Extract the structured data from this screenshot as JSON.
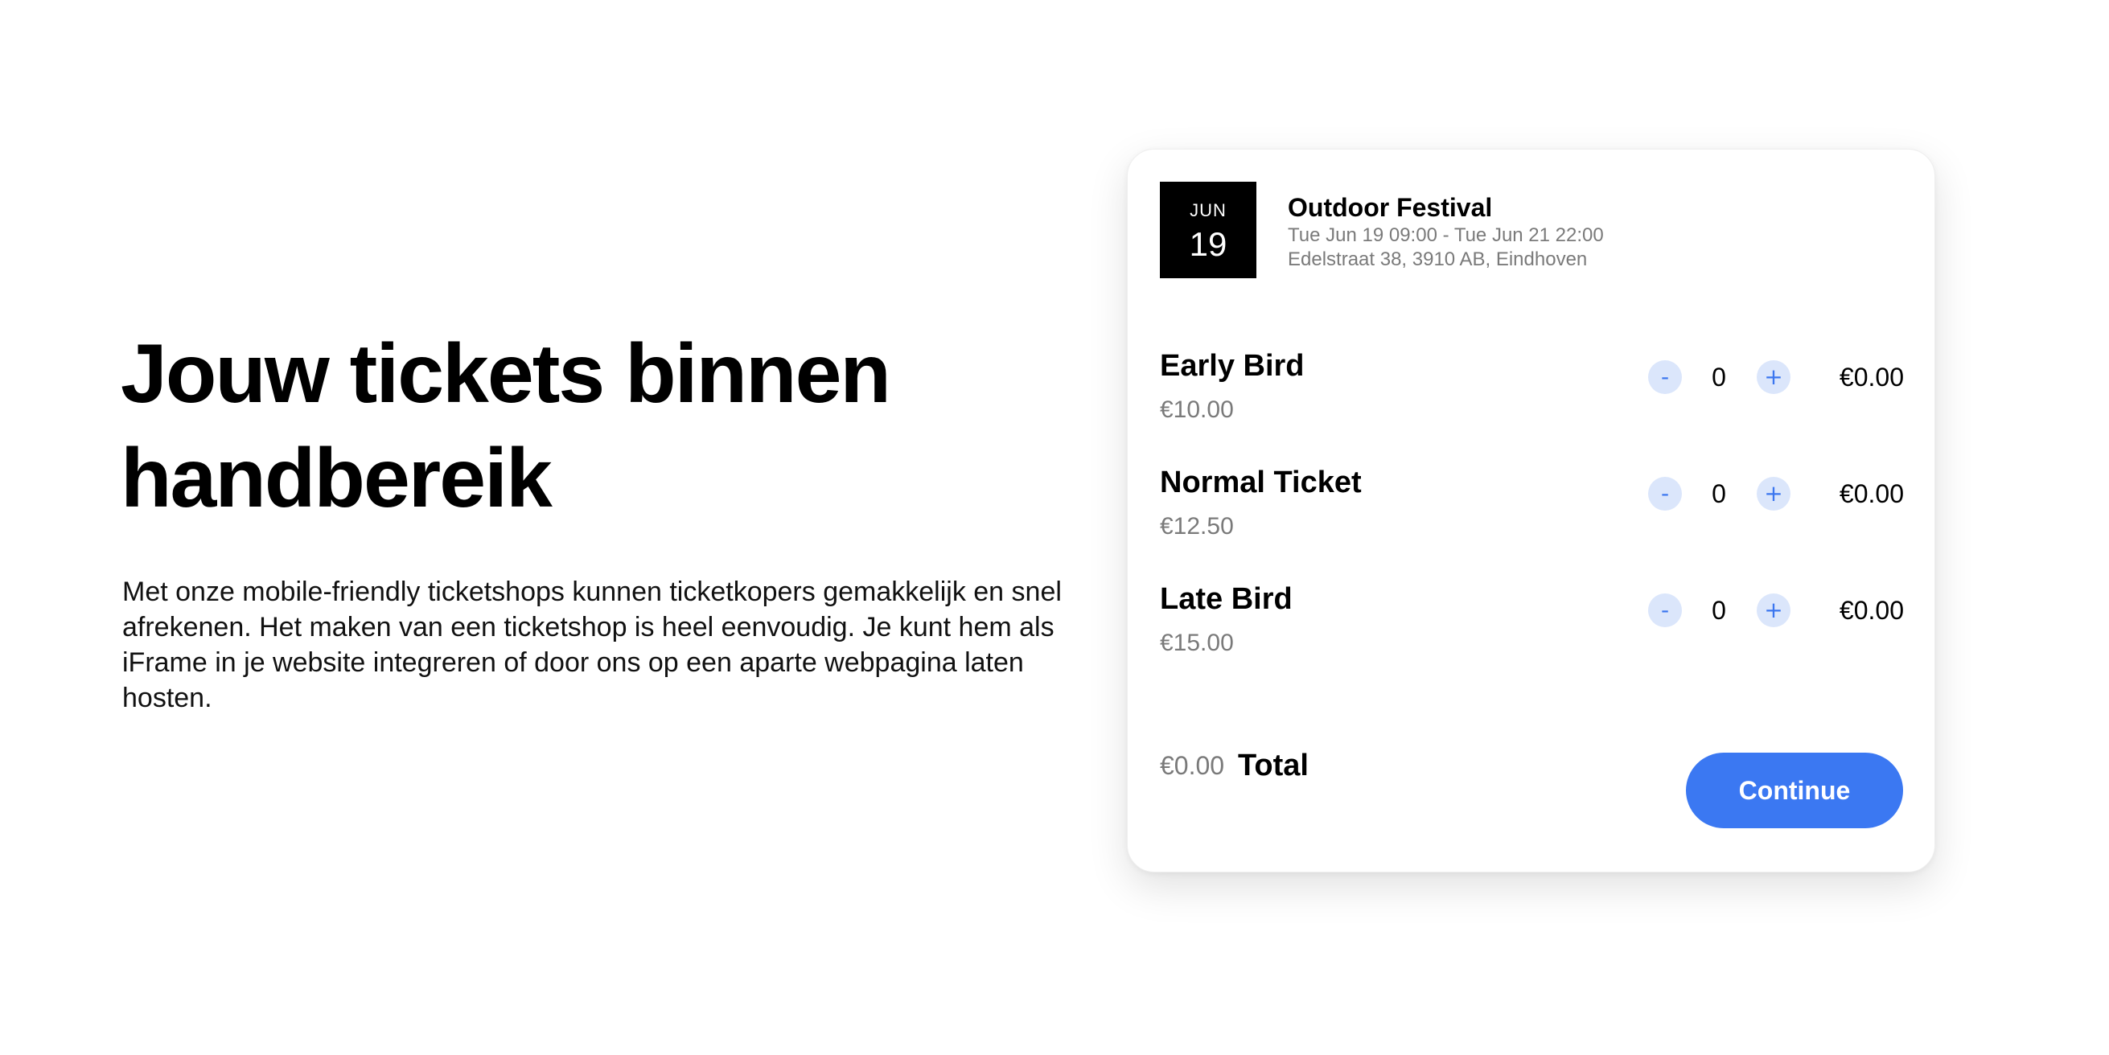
{
  "hero": {
    "title_line1": "Jouw tickets binnen",
    "title_line2": "handbereik",
    "description": "Met onze mobile-friendly ticketshops kunnen ticketkopers gemakkelijk en snel afrekenen. Het maken van een ticketshop is heel eenvoudig. Je kunt hem als iFrame in je website integreren of door ons op een aparte webpagina laten hosten."
  },
  "event": {
    "month": "JUN",
    "day": "19",
    "name": "Outdoor Festival",
    "datetime": "Tue Jun 19 09:00 - Tue Jun 21 22:00",
    "address": "Edelstraat 38, 3910 AB, Eindhoven"
  },
  "tickets": [
    {
      "name": "Early Bird",
      "price": "€10.00",
      "quantity": "0",
      "subtotal": "€0.00",
      "minus": "-",
      "plus": "+"
    },
    {
      "name": "Normal Ticket",
      "price": "€12.50",
      "quantity": "0",
      "subtotal": "€0.00",
      "minus": "-",
      "plus": "+"
    },
    {
      "name": "Late Bird",
      "price": "€15.00",
      "quantity": "0",
      "subtotal": "€0.00",
      "minus": "-",
      "plus": "+"
    }
  ],
  "summary": {
    "total_amount": "€0.00",
    "total_label": "Total",
    "continue_label": "Continue"
  },
  "colors": {
    "accent": "#3b78f2",
    "button_light": "#dbe6fb",
    "muted_text": "#7a7a7a"
  }
}
